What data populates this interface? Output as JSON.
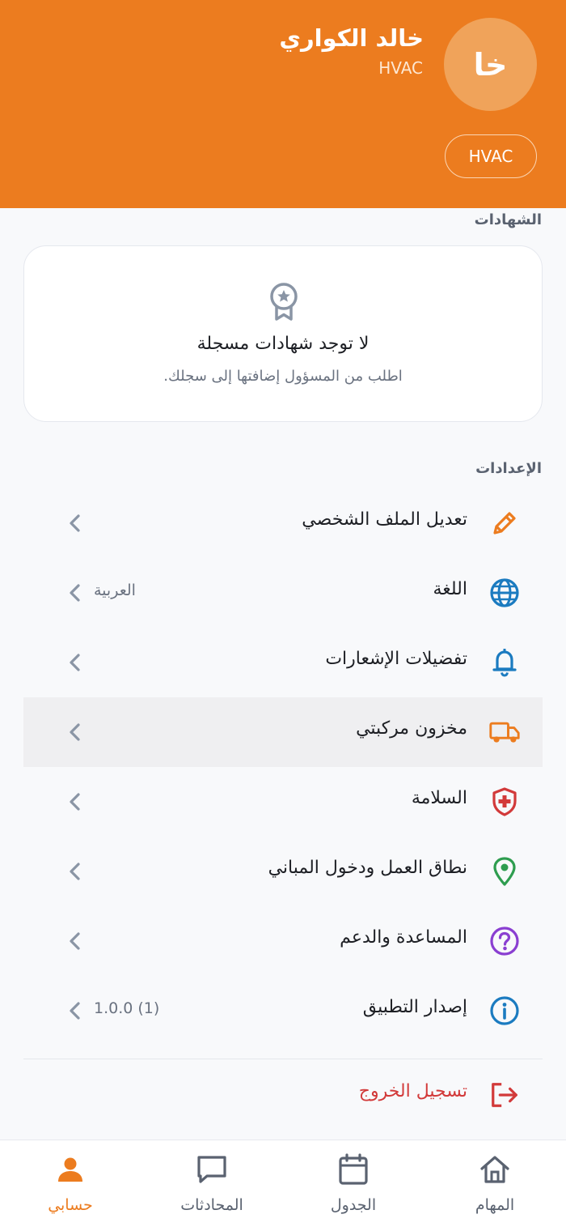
{
  "profile": {
    "avatar_initials": "خا",
    "name": "خالد الكواري",
    "role": "HVAC",
    "role_chip": "HVAC"
  },
  "certificates": {
    "section_title": "الشهادات",
    "empty_icon": "award-icon",
    "empty_title": "لا توجد شهادات مسجلة",
    "empty_subtitle": "اطلب من المسؤول إضافتها إلى سجلك."
  },
  "settings": {
    "section_title": "الإعدادات",
    "items": [
      {
        "label": "تعديل الملف الشخصي",
        "icon": "pencil-icon",
        "color": "#ec7c1f",
        "value": ""
      },
      {
        "label": "اللغة",
        "icon": "globe-icon",
        "color": "#1b7bc0",
        "value": "العربية"
      },
      {
        "label": "تفضيلات الإشعارات",
        "icon": "bell-icon",
        "color": "#1b7bc0",
        "value": ""
      },
      {
        "label": "مخزون مركبتي",
        "icon": "truck-icon",
        "color": "#ec7c1f",
        "value": ""
      },
      {
        "label": "السلامة",
        "icon": "shield-plus-icon",
        "color": "#d23a3a",
        "value": ""
      },
      {
        "label": "نطاق العمل ودخول المباني",
        "icon": "map-pin-icon",
        "color": "#2e9d4f",
        "value": ""
      },
      {
        "label": "المساعدة والدعم",
        "icon": "help-circle-icon",
        "color": "#8a3fd1",
        "value": ""
      },
      {
        "label": "إصدار التطبيق",
        "icon": "info-icon",
        "color": "#1b7bc0",
        "value": "1.0.0 (1)"
      }
    ]
  },
  "logout": {
    "label": "تسجيل الخروج",
    "icon": "logout-icon",
    "color": "#d23a3a"
  },
  "bottom_nav": {
    "items": [
      {
        "label": "حسابي",
        "icon": "user-icon",
        "active": true
      },
      {
        "label": "المحادثات",
        "icon": "chat-icon",
        "active": false
      },
      {
        "label": "الجدول",
        "icon": "calendar-icon",
        "active": false
      },
      {
        "label": "المهام",
        "icon": "home-icon",
        "active": false
      }
    ]
  },
  "colors": {
    "brand": "#ec7c1f",
    "danger": "#d23a3a",
    "muted": "#6a7280",
    "background": "#f8f9fb"
  }
}
